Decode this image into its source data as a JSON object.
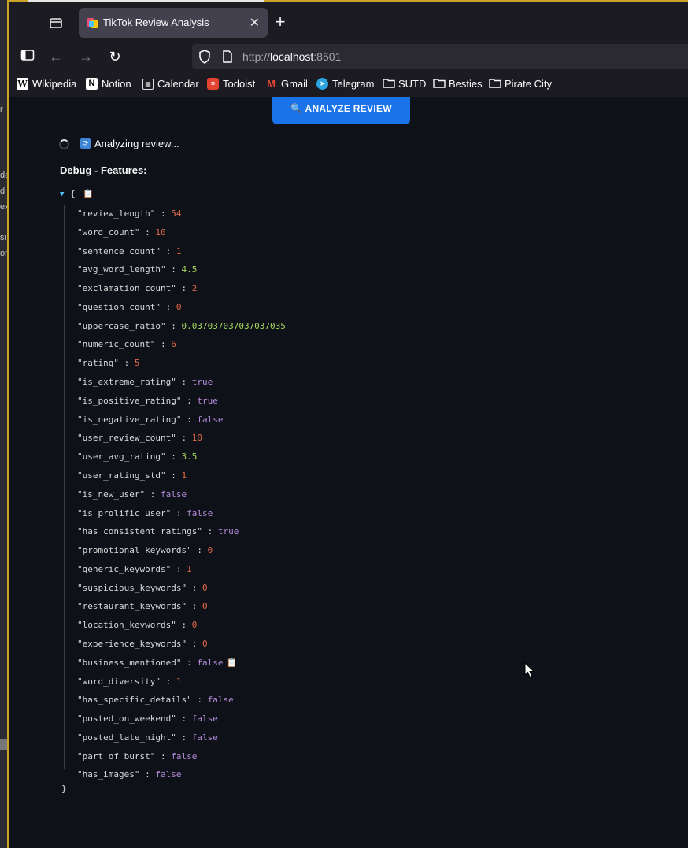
{
  "browser": {
    "tab_title": "TikTok Review Analysis",
    "url_prefix": "http://",
    "url_host": "localhost",
    "url_port": ":8501"
  },
  "bookmarks": [
    "Wikipedia",
    "Notion",
    "Calendar",
    "Todoist",
    "Gmail",
    "Telegram",
    "SUTD",
    "Besties",
    "Pirate City"
  ],
  "page": {
    "analyze_button": "🔍 ANALYZE REVIEW",
    "status_text": "Analyzing review...",
    "debug_title": "Debug - Features:",
    "json_open": "{",
    "json_close": "}"
  },
  "features": [
    {
      "key": "review_length",
      "value": "54",
      "type": "int"
    },
    {
      "key": "word_count",
      "value": "10",
      "type": "int"
    },
    {
      "key": "sentence_count",
      "value": "1",
      "type": "int"
    },
    {
      "key": "avg_word_length",
      "value": "4.5",
      "type": "float"
    },
    {
      "key": "exclamation_count",
      "value": "2",
      "type": "int"
    },
    {
      "key": "question_count",
      "value": "0",
      "type": "int"
    },
    {
      "key": "uppercase_ratio",
      "value": "0.037037037037037035",
      "type": "float"
    },
    {
      "key": "numeric_count",
      "value": "6",
      "type": "int"
    },
    {
      "key": "rating",
      "value": "5",
      "type": "int"
    },
    {
      "key": "is_extreme_rating",
      "value": "true",
      "type": "bool"
    },
    {
      "key": "is_positive_rating",
      "value": "true",
      "type": "bool"
    },
    {
      "key": "is_negative_rating",
      "value": "false",
      "type": "bool"
    },
    {
      "key": "user_review_count",
      "value": "10",
      "type": "int"
    },
    {
      "key": "user_avg_rating",
      "value": "3.5",
      "type": "float"
    },
    {
      "key": "user_rating_std",
      "value": "1",
      "type": "int"
    },
    {
      "key": "is_new_user",
      "value": "false",
      "type": "bool"
    },
    {
      "key": "is_prolific_user",
      "value": "false",
      "type": "bool"
    },
    {
      "key": "has_consistent_ratings",
      "value": "true",
      "type": "bool"
    },
    {
      "key": "promotional_keywords",
      "value": "0",
      "type": "int"
    },
    {
      "key": "generic_keywords",
      "value": "1",
      "type": "int"
    },
    {
      "key": "suspicious_keywords",
      "value": "0",
      "type": "int"
    },
    {
      "key": "restaurant_keywords",
      "value": "0",
      "type": "int"
    },
    {
      "key": "location_keywords",
      "value": "0",
      "type": "int"
    },
    {
      "key": "experience_keywords",
      "value": "0",
      "type": "int"
    },
    {
      "key": "business_mentioned",
      "value": "false",
      "type": "bool",
      "copy_icon": true
    },
    {
      "key": "word_diversity",
      "value": "1",
      "type": "int"
    },
    {
      "key": "has_specific_details",
      "value": "false",
      "type": "bool"
    },
    {
      "key": "posted_on_weekend",
      "value": "false",
      "type": "bool"
    },
    {
      "key": "posted_late_night",
      "value": "false",
      "type": "bool"
    },
    {
      "key": "part_of_burst",
      "value": "false",
      "type": "bool"
    },
    {
      "key": "has_images",
      "value": "false",
      "type": "bool"
    }
  ],
  "left_window_fragments": [
    "r",
    "de",
    "d",
    "ex",
    "si",
    "or"
  ],
  "colors": {
    "background": "#0e1117",
    "button": "#1a73e8",
    "json_int": "#e0694a",
    "json_float": "#a4d65e",
    "json_bool": "#b48ad9"
  },
  "icons": {
    "analyze": "magnifier-icon",
    "status": "refresh-icon",
    "copy": "clipboard-icon"
  }
}
